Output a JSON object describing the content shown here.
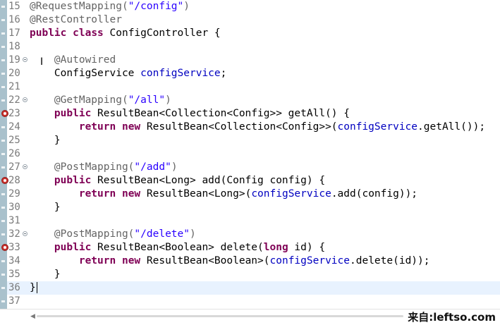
{
  "editor": {
    "lines": [
      {
        "n": "15",
        "tokens": [
          {
            "t": "@RequestMapping(",
            "c": "ann"
          },
          {
            "t": "\"/config\"",
            "c": "str"
          },
          {
            "t": ")",
            "c": "ann"
          }
        ]
      },
      {
        "n": "16",
        "tokens": [
          {
            "t": "@RestController",
            "c": "ann"
          }
        ]
      },
      {
        "n": "17",
        "tokens": [
          {
            "t": "public",
            "c": "kw"
          },
          {
            "t": " "
          },
          {
            "t": "class",
            "c": "kw"
          },
          {
            "t": " ConfigController {"
          }
        ]
      },
      {
        "n": "18",
        "tokens": []
      },
      {
        "n": "19",
        "fold": true,
        "tokens": [
          {
            "t": "    "
          },
          {
            "t": "@Autowired",
            "c": "ann"
          }
        ]
      },
      {
        "n": "20",
        "tokens": [
          {
            "t": "    ConfigService "
          },
          {
            "t": "configService",
            "c": "fld"
          },
          {
            "t": ";"
          }
        ]
      },
      {
        "n": "21",
        "tokens": []
      },
      {
        "n": "22",
        "fold": true,
        "tokens": [
          {
            "t": "    "
          },
          {
            "t": "@GetMapping(",
            "c": "ann"
          },
          {
            "t": "\"/all\"",
            "c": "str"
          },
          {
            "t": ")",
            "c": "ann"
          }
        ]
      },
      {
        "n": "23",
        "override": true,
        "tokens": [
          {
            "t": "    "
          },
          {
            "t": "public",
            "c": "kw"
          },
          {
            "t": " ResultBean<Collection<Config>> getAll() {"
          }
        ]
      },
      {
        "n": "24",
        "tokens": [
          {
            "t": "        "
          },
          {
            "t": "return",
            "c": "kw"
          },
          {
            "t": " "
          },
          {
            "t": "new",
            "c": "kw"
          },
          {
            "t": " ResultBean<Collection<Config>>("
          },
          {
            "t": "configService",
            "c": "fld"
          },
          {
            "t": ".getAll());"
          }
        ]
      },
      {
        "n": "25",
        "tokens": [
          {
            "t": "    }"
          }
        ]
      },
      {
        "n": "26",
        "tokens": []
      },
      {
        "n": "27",
        "fold": true,
        "tokens": [
          {
            "t": "    "
          },
          {
            "t": "@PostMapping(",
            "c": "ann"
          },
          {
            "t": "\"/add\"",
            "c": "str"
          },
          {
            "t": ")",
            "c": "ann"
          }
        ]
      },
      {
        "n": "28",
        "override": true,
        "tokens": [
          {
            "t": "    "
          },
          {
            "t": "public",
            "c": "kw"
          },
          {
            "t": " ResultBean<Long> add(Config config) {"
          }
        ]
      },
      {
        "n": "29",
        "tokens": [
          {
            "t": "        "
          },
          {
            "t": "return",
            "c": "kw"
          },
          {
            "t": " "
          },
          {
            "t": "new",
            "c": "kw"
          },
          {
            "t": " ResultBean<Long>("
          },
          {
            "t": "configService",
            "c": "fld"
          },
          {
            "t": ".add(config));"
          }
        ]
      },
      {
        "n": "30",
        "tokens": [
          {
            "t": "    }"
          }
        ]
      },
      {
        "n": "31",
        "tokens": []
      },
      {
        "n": "32",
        "fold": true,
        "tokens": [
          {
            "t": "    "
          },
          {
            "t": "@PostMapping(",
            "c": "ann"
          },
          {
            "t": "\"/delete\"",
            "c": "str"
          },
          {
            "t": ")",
            "c": "ann"
          }
        ]
      },
      {
        "n": "33",
        "override": true,
        "tokens": [
          {
            "t": "    "
          },
          {
            "t": "public",
            "c": "kw"
          },
          {
            "t": " ResultBean<Boolean> delete("
          },
          {
            "t": "long",
            "c": "kw"
          },
          {
            "t": " id) {"
          }
        ]
      },
      {
        "n": "34",
        "tokens": [
          {
            "t": "        "
          },
          {
            "t": "return",
            "c": "kw"
          },
          {
            "t": " "
          },
          {
            "t": "new",
            "c": "kw"
          },
          {
            "t": " ResultBean<Boolean>("
          },
          {
            "t": "configService",
            "c": "fld"
          },
          {
            "t": ".delete(id));"
          }
        ]
      },
      {
        "n": "35",
        "tokens": [
          {
            "t": "    }"
          }
        ]
      },
      {
        "n": "36",
        "current": true,
        "tokens": [
          {
            "t": "}"
          }
        ]
      },
      {
        "n": "37",
        "tokens": []
      }
    ],
    "cursor_icon": "text-cursor-icon",
    "fold_icon": "fold-collapse-icon",
    "override_icon": "override-marker-icon"
  },
  "colors": {
    "keyword": "#7f0055",
    "annotation": "#646464",
    "string": "#2a00ff",
    "field": "#0000c0",
    "current_line": "#e8f2fe"
  },
  "watermark": {
    "text": "来自:leftso.com"
  }
}
